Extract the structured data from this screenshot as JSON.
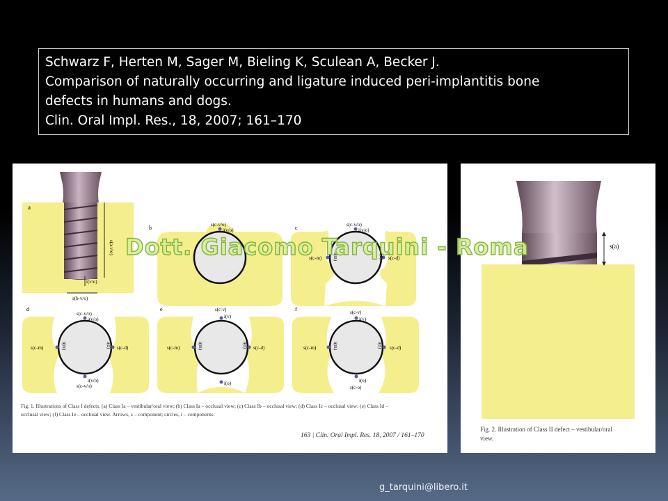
{
  "citation": {
    "line1": "Schwarz F, Herten M, Sager M, Bieling K, Sculean A, Becker J.",
    "line2": "Comparison of naturally occurring and ligature induced peri-implantitis bone",
    "line3": "defects in humans and dogs.",
    "line4": "Clin. Oral Impl. Res., 18, 2007; 161–170"
  },
  "figure1": {
    "panels": {
      "a": {
        "letter": "a",
        "labels": [
          "s(a-v/o)",
          "i(v/o)",
          "s(b-v/o)"
        ]
      },
      "b": {
        "letter": "b",
        "labels": [
          "s(c-v/o)",
          "i(v/o)"
        ]
      },
      "c": {
        "letter": "c",
        "labels": [
          "s(c-v/o)",
          "i(v/o)",
          "i(m)",
          "s(c-m)",
          "i(d)",
          "s(c-d)"
        ]
      },
      "d": {
        "letter": "d",
        "labels": [
          "s(c-v/o)",
          "i(v/o)",
          "s(c-m)",
          "i(m)",
          "i(d)",
          "s(c-d)",
          "i(v/o)",
          "s(c-v/o)"
        ]
      },
      "e": {
        "letter": "e",
        "labels": [
          "s(c-v)",
          "i(v)",
          "s(c-m)",
          "i(m)",
          "i(d)",
          "s(c-d)",
          "i(o)"
        ]
      },
      "f": {
        "letter": "f",
        "labels": [
          "s(c-v)",
          "i(v)",
          "s(c-m)",
          "i(m)",
          "i(d)",
          "s(c-d)",
          "i(o)",
          "s(c-o)"
        ]
      }
    },
    "caption_line1": "Fig. 1.  Illustrations of Class I defects. (a) Class Ia – vestibular/oral view; (b) Class Ia – occlusal view; (c) Class Ib – occlusal view; (d) Class Ic – occlusal view; (e) Class Id –",
    "caption_line2": "occlusal view; (f) Class Ie – occlusal view. Arrows, s – component; circles, i – components.",
    "page_footer": "163  |  Clin. Oral Impl. Res. 18, 2007 / 161–170"
  },
  "figure2": {
    "label": "s(a)",
    "caption_line1": "Fig. 2.  Illustration of Class II defect – vestibular/oral",
    "caption_line2": "view."
  },
  "watermark": "Dott. Giacomo Tarquini - Roma",
  "email": "g_tarquini@libero.it",
  "colors": {
    "bone": "#f5ee8c",
    "implant": "#8c6f80",
    "defect": "#e8e8e8",
    "marker": "#5a5aa0"
  }
}
